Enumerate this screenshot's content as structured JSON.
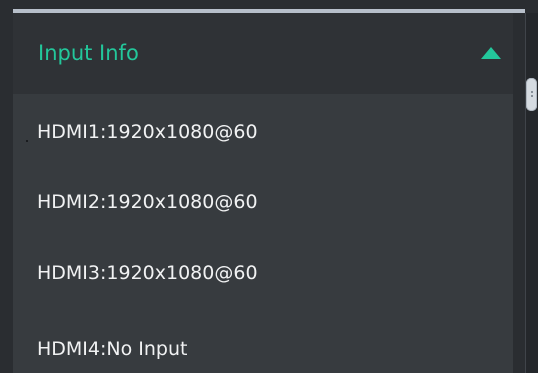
{
  "panel": {
    "title": "Input Info",
    "toggle_icon": "triangle-up-icon",
    "accent_color": "#23c79b"
  },
  "inputs": [
    {
      "text": "HDMI1:1920x1080@60"
    },
    {
      "text": "HDMI2:1920x1080@60"
    },
    {
      "text": "HDMI3:1920x1080@60"
    },
    {
      "text": "HDMI4:No Input"
    }
  ],
  "ui": {
    "divider_handle_icon": "drag-handle-icon"
  }
}
